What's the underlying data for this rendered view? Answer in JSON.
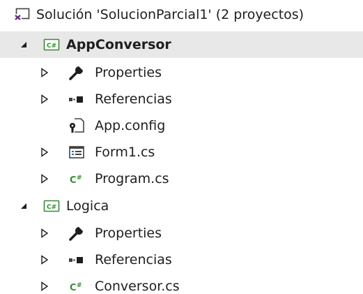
{
  "solution": {
    "label": "Solución 'SolucionParcial1'  (2 proyectos)",
    "icon": "solution-icon"
  },
  "projects": [
    {
      "label": "AppConversor",
      "icon": "csharp-project-icon",
      "expanded": true,
      "selected": true,
      "bold": true,
      "children": [
        {
          "label": "Properties",
          "icon": "wrench-icon",
          "expandable": true
        },
        {
          "label": "Referencias",
          "icon": "references-icon",
          "expandable": true
        },
        {
          "label": "App.config",
          "icon": "config-file-icon",
          "expandable": false
        },
        {
          "label": "Form1.cs",
          "icon": "form-icon",
          "expandable": true
        },
        {
          "label": "Program.cs",
          "icon": "csharp-file-icon",
          "expandable": true
        }
      ]
    },
    {
      "label": "Logica",
      "icon": "csharp-project-icon",
      "expanded": true,
      "selected": false,
      "bold": false,
      "children": [
        {
          "label": "Properties",
          "icon": "wrench-icon",
          "expandable": true
        },
        {
          "label": "Referencias",
          "icon": "references-icon",
          "expandable": true
        },
        {
          "label": "Conversor.cs",
          "icon": "csharp-file-icon",
          "expandable": true
        }
      ]
    }
  ],
  "colors": {
    "selection": "#e8e8e8",
    "csharp_green": "#388a34",
    "text": "#1e1e1e",
    "arrow": "#1e1e1e"
  }
}
